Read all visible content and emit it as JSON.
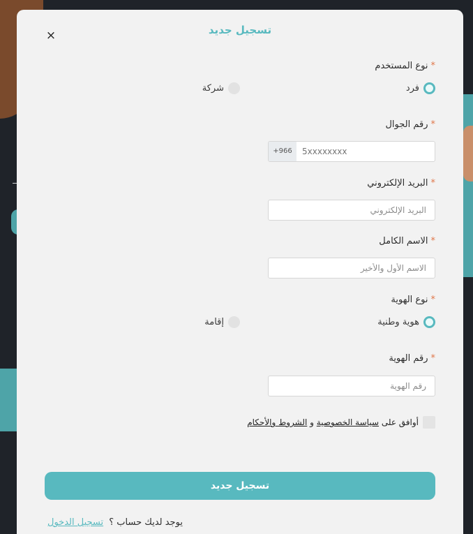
{
  "modal": {
    "title": "تسجيل جديد",
    "close_symbol": "×"
  },
  "user_type": {
    "label": "نوع المستخدم",
    "options": [
      {
        "label": "فرد",
        "selected": true
      },
      {
        "label": "شركة",
        "selected": false
      }
    ]
  },
  "phone": {
    "label": "رقم الجوال",
    "prefix": "+966",
    "placeholder": "5xxxxxxxx"
  },
  "email": {
    "label": "البريد الإلكتروني",
    "placeholder": "البريد الإلكتروني"
  },
  "full_name": {
    "label": "الاسم الكامل",
    "placeholder": "الاسم الأول والأخير"
  },
  "id_type": {
    "label": "نوع الهوية",
    "options": [
      {
        "label": "هوية وطنية",
        "selected": true
      },
      {
        "label": "إقامة",
        "selected": false
      }
    ]
  },
  "id_number": {
    "label": "رقم الهوية",
    "placeholder": "رقم الهوية"
  },
  "agreement": {
    "prefix": "أوافق على",
    "privacy_link": "سياسة الخصوصية",
    "conjunction": "و",
    "terms_link": "الشروط والأحكام",
    "checked": false
  },
  "submit_label": "تسجيل جديد",
  "login": {
    "question": "يوجد لديك حساب ؟",
    "link": "تسجيل الدخول"
  },
  "required_marker": "*",
  "colors": {
    "accent": "#58b9bf",
    "required": "#e0774a"
  }
}
